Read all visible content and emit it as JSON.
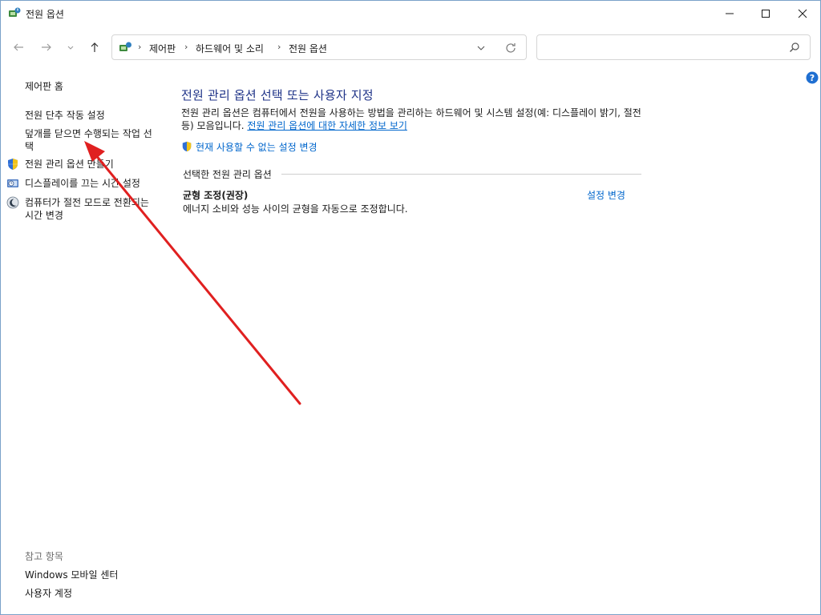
{
  "window": {
    "title": "전원 옵션"
  },
  "nav": {
    "breadcrumbs": [
      "제어판",
      "하드웨어 및 소리",
      "전원 옵션"
    ],
    "search_placeholder": ""
  },
  "sidebar": {
    "home": "제어판 홈",
    "items": [
      {
        "label": "전원 단추 작동 설정",
        "icon": ""
      },
      {
        "label": "덮개를 닫으면 수행되는 작업 선택",
        "icon": ""
      },
      {
        "label": "전원 관리 옵션 만들기",
        "icon": "uac-shield-icon"
      },
      {
        "label": "디스플레이를 끄는 시간 설정",
        "icon": "display-clock-icon"
      },
      {
        "label": "컴퓨터가 절전 모드로 전환되는 시간 변경",
        "icon": "moon-icon"
      }
    ],
    "see_also": {
      "heading": "참고 항목",
      "links": [
        "Windows 모바일 센터",
        "사용자 계정"
      ]
    }
  },
  "main": {
    "title": "전원 관리 옵션 선택 또는 사용자 지정",
    "description": "전원 관리 옵션은 컴퓨터에서 전원을 사용하는 방법을 관리하는 하드웨어 및 시스템 설정(예: 디스플레이 밝기, 절전 등) 모음입니다.",
    "more_info_link": "전원 관리 옵션에 대한 자세한 정보 보기",
    "change_unavailable_link": "현재 사용할 수 없는 설정 변경",
    "section_label": "선택한 전원 관리 옵션",
    "plan": {
      "name": "균형 조정(권장)",
      "description": "에너지 소비와 성능 사이의 균형을 자동으로 조정합니다.",
      "change_link": "설정 변경"
    }
  },
  "colors": {
    "title_blue": "#1e3287",
    "link_blue": "#0066cc",
    "annotation_red": "#e02020"
  }
}
